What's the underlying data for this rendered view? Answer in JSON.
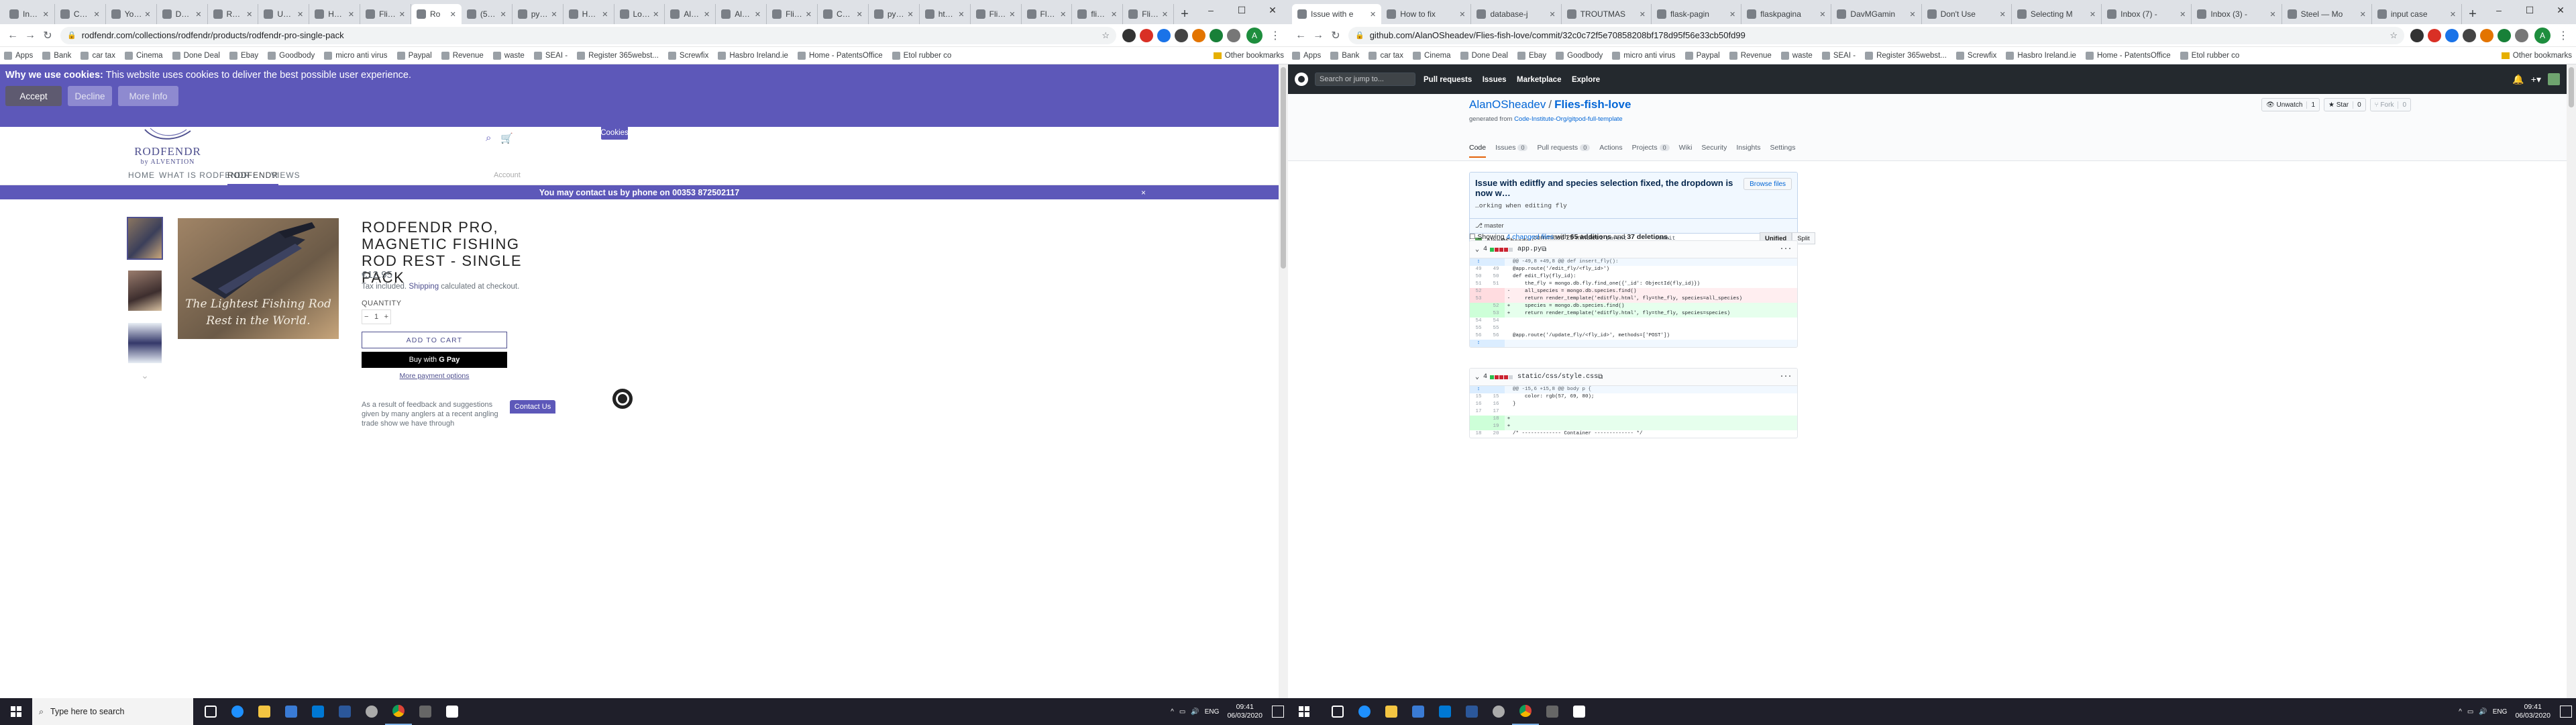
{
  "left": {
    "tabs": [
      "Inbox",
      "Confir",
      "Your V",
      "Data i",
      "Roma",
      "Under",
      "HTML",
      "Flies F",
      "Ro",
      "(5) Ru",
      "pytho",
      "Home",
      "Logo",
      "Alvent",
      "AlanO",
      "Flies F",
      "CSS F",
      "pytho",
      "html -",
      "Flies F",
      "Flex -",
      "flies-f",
      "Flies F"
    ],
    "active_tab_index": 8,
    "url": "rodfendr.com/collections/rodfendr/products/rodfendr-pro-single-pack",
    "bookmarks": [
      "Apps",
      "Bank",
      "car tax",
      "Cinema",
      "Done Deal",
      "Ebay",
      "Goodbody",
      "micro anti virus",
      "Paypal",
      "Revenue",
      "waste",
      "SEAI -",
      "Register 365webst...",
      "Screwfix",
      "Hasbro Ireland.ie",
      "Home - PatentsOffice",
      "Etol rubber co"
    ],
    "other_bookmarks": "Other bookmarks",
    "avatar_letter": "A",
    "cookie": {
      "bold": "Why we use cookies:",
      "text": " This website uses cookies to deliver the best possible user experience.",
      "accept": "Accept",
      "decline": "Decline",
      "more": "More Info"
    },
    "cookies_button": "Cookies",
    "logo": {
      "name": "RODFENDR",
      "sub": "by ALVENTION"
    },
    "nav": [
      "HOME",
      "WHAT IS RODFENDR",
      "RODFENDR",
      "VIEWS"
    ],
    "nav_active": 2,
    "account": "Account",
    "announcement": "You may contact us by phone on 00353 872502117",
    "announcement_close": "×",
    "product": {
      "title": "RODFENDR PRO, MAGNETIC FISHING ROD REST - SINGLE PACK",
      "price": "€12.95",
      "tax_pre": "Tax included. ",
      "tax_link": "Shipping",
      "tax_post": " calculated at checkout.",
      "quantity_label": "QUANTITY",
      "quantity": "1",
      "add_to_cart": "ADD TO CART",
      "buy_with": "Buy with",
      "gpay": "G Pay",
      "more_payment": "More payment options",
      "image_text_line1": "The Lightest Fishing Rod",
      "image_text_line2": "Rest in the World.",
      "description": "As a result of feedback and suggestions given by many anglers at a recent angling trade show we have through"
    },
    "contact_us": "Contact Us",
    "taskbar": {
      "search_placeholder": "Type here to search",
      "lang": "ENG",
      "time": "09:41",
      "date": "06/03/2020"
    }
  },
  "right": {
    "tabs": [
      "Issue with e",
      "How to fix",
      "database-j",
      "TROUTMAS",
      "flask-pagin",
      "flaskpagina",
      "DavMGamin",
      "Don't Use",
      "Selecting M",
      "Inbox (7) -",
      "Inbox (3) -",
      "Steel — Mo",
      "input case"
    ],
    "active_tab_index": 0,
    "url": "github.com/AlanOSheadev/Flies-fish-love/commit/32c0c72f5e70858208bf178d95f56e33cb50fd99",
    "bookmarks": [
      "Apps",
      "Bank",
      "car tax",
      "Cinema",
      "Done Deal",
      "Ebay",
      "Goodbody",
      "micro anti virus",
      "Paypal",
      "Revenue",
      "waste",
      "SEAI -",
      "Register 365webst...",
      "Screwfix",
      "Hasbro Ireland.ie",
      "Home - PatentsOffice",
      "Etol rubber co"
    ],
    "other_bookmarks": "Other bookmarks",
    "avatar_letter": "A",
    "gh": {
      "search": "Search or jump to...",
      "nav": [
        "Pull requests",
        "Issues",
        "Marketplace",
        "Explore"
      ],
      "owner": "AlanOSheadev",
      "repo": "Flies-fish-love",
      "generated_pre": "generated from ",
      "generated_link": "Code-Institute-Org/gitpod-full-template",
      "unwatch": "Unwatch",
      "unwatch_count": "1",
      "star": "Star",
      "star_count": "0",
      "fork": "Fork",
      "fork_count": "0",
      "tabs": [
        {
          "label": "Code",
          "count": ""
        },
        {
          "label": "Issues",
          "count": "0"
        },
        {
          "label": "Pull requests",
          "count": "0"
        },
        {
          "label": "Actions",
          "count": ""
        },
        {
          "label": "Projects",
          "count": "0"
        },
        {
          "label": "Wiki",
          "count": ""
        },
        {
          "label": "Security",
          "count": ""
        },
        {
          "label": "Insights",
          "count": ""
        },
        {
          "label": "Settings",
          "count": ""
        }
      ],
      "commit": {
        "title": "Issue with editfly and species selection fixed, the dropdown is now w…",
        "desc": "…orking when editing fly",
        "browse": "Browse files",
        "branch": "master",
        "author": "AlanOSheadev",
        "when": " committed 25 minutes ago",
        "parent": "1 parent 17077de",
        "commit": "commit 32c0c72f5e70858208bf178d95f56e33cb50fd99"
      },
      "showing_pre": "Showing ",
      "showing_link": "4 changed files",
      "showing_mid": " with ",
      "additions": "65 additions",
      "and": " and ",
      "deletions": "37 deletions",
      "showing_end": ".",
      "unified": "Unified",
      "split": "Split",
      "files": [
        {
          "count": "4",
          "name": "app.py",
          "lines": [
            {
              "t": "exp",
              "a": "↕",
              "b": "",
              "s": "",
              "c": "@@ -49,8 +49,8 @@ def insert_fly():"
            },
            {
              "t": "ctx",
              "a": "49",
              "b": "49",
              "s": "",
              "c": "@app.route('/edit_fly/<fly_id>')"
            },
            {
              "t": "ctx",
              "a": "50",
              "b": "50",
              "s": "",
              "c": "def edit_fly(fly_id):"
            },
            {
              "t": "ctx",
              "a": "51",
              "b": "51",
              "s": "",
              "c": "    the_fly = mongo.db.fly.find_one({'_id': ObjectId(fly_id)})"
            },
            {
              "t": "del",
              "a": "52",
              "b": "",
              "s": "-",
              "c": "    all_species = mongo.db.species.find()"
            },
            {
              "t": "del",
              "a": "53",
              "b": "",
              "s": "-",
              "c": "    return render_template('editfly.html', fly=the_fly, species=all_species)"
            },
            {
              "t": "add",
              "a": "",
              "b": "52",
              "s": "+",
              "c": "    species = mongo.db.species.find()"
            },
            {
              "t": "add",
              "a": "",
              "b": "53",
              "s": "+",
              "c": "    return render_template('editfly.html', fly=the_fly, species=species)"
            },
            {
              "t": "ctx",
              "a": "54",
              "b": "54",
              "s": "",
              "c": ""
            },
            {
              "t": "ctx",
              "a": "55",
              "b": "55",
              "s": "",
              "c": ""
            },
            {
              "t": "ctx",
              "a": "56",
              "b": "56",
              "s": "",
              "c": "@app.route('/update_fly/<fly_id>', methods=['POST'])"
            },
            {
              "t": "exp",
              "a": "↕",
              "b": "",
              "s": "",
              "c": ""
            }
          ]
        },
        {
          "count": "4",
          "name": "static/css/style.css",
          "lines": [
            {
              "t": "exp",
              "a": "↕",
              "b": "",
              "s": "",
              "c": "@@ -15,6 +15,8 @@ body p {"
            },
            {
              "t": "ctx",
              "a": "15",
              "b": "15",
              "s": "",
              "c": "    color: rgb(57, 69, 80);"
            },
            {
              "t": "ctx",
              "a": "16",
              "b": "16",
              "s": "",
              "c": "}"
            },
            {
              "t": "ctx",
              "a": "17",
              "b": "17",
              "s": "",
              "c": ""
            },
            {
              "t": "add",
              "a": "",
              "b": "18",
              "s": "+",
              "c": ""
            },
            {
              "t": "add",
              "a": "",
              "b": "19",
              "s": "+",
              "c": ""
            },
            {
              "t": "ctx",
              "a": "18",
              "b": "20",
              "s": "",
              "c": "/* ------------- Container ------------- */"
            }
          ]
        }
      ]
    },
    "taskbar": {
      "lang": "ENG",
      "time": "09:41",
      "date": "06/03/2020"
    }
  },
  "colors": {
    "brand": "#5d58b9",
    "gh_dark": "#24292e",
    "link": "#0366d6"
  }
}
